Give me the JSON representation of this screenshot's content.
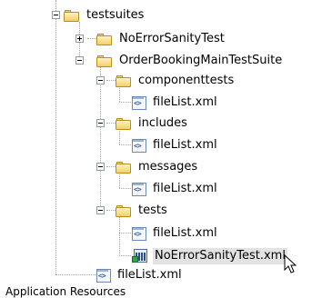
{
  "tree": {
    "testsuites": {
      "label": "testsuites"
    },
    "no_error_sanity_test_folder": {
      "label": "NoErrorSanityTest"
    },
    "order_booking_main_test_suite": {
      "label": "OrderBookingMainTestSuite"
    },
    "componenttests": {
      "label": "componenttests",
      "file": "fileList.xml"
    },
    "includes": {
      "label": "includes",
      "file": "fileList.xml"
    },
    "messages": {
      "label": "messages",
      "file": "fileList.xml"
    },
    "tests": {
      "label": "tests",
      "file": "fileList.xml",
      "test_file": "NoErrorSanityTest.xml"
    },
    "root_file": "fileList.xml"
  },
  "footer": {
    "label": "Application Resources"
  },
  "icons": {
    "folder": "folder-icon",
    "xml": "xml-file-icon",
    "test": "test-suite-file-icon",
    "collapse": "collapse-toggle-icon",
    "expand": "expand-toggle-icon",
    "cursor": "mouse-cursor-icon"
  },
  "colors": {
    "selection": "#e3e3e3",
    "folder": "#f2cf68",
    "guide": "#a9a9a9"
  }
}
